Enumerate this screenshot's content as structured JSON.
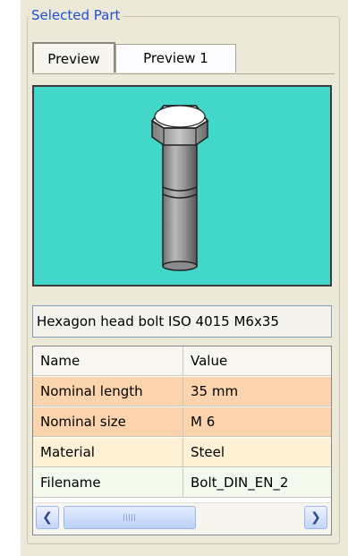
{
  "group_title": "Selected Part",
  "tabs": [
    {
      "label": "Preview",
      "active": true
    },
    {
      "label": "Preview 1",
      "active": false
    }
  ],
  "preview": {
    "background_color": "#42d7c8",
    "image_icon": "hexagon-bolt-3d-render"
  },
  "description": "Hexagon head bolt ISO 4015 M6x35",
  "properties": {
    "headers": [
      "Name",
      "Value"
    ],
    "rows": [
      {
        "name": "Nominal length",
        "value": "35 mm",
        "color": "#fbd4ad"
      },
      {
        "name": "Nominal size",
        "value": "M 6",
        "color": "#fbd4ad"
      },
      {
        "name": "Material",
        "value": "Steel",
        "color": "#fff1d4"
      },
      {
        "name": "Filename",
        "value": "Bolt_DIN_EN_2",
        "color": "#f3f9ec"
      }
    ]
  },
  "scrollbar": {
    "left_icon": "arrow-left-icon",
    "right_icon": "arrow-right-icon"
  }
}
